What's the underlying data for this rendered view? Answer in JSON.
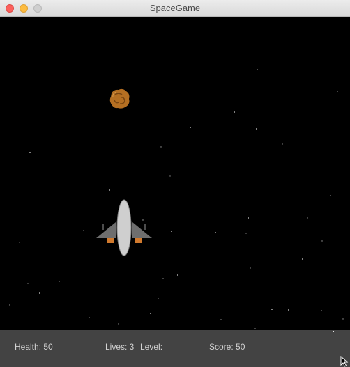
{
  "window": {
    "title": "SpaceGame"
  },
  "hud": {
    "health": "Health: 50",
    "lives": "Lives: 3",
    "level": "Level:",
    "score": "Score: 50"
  },
  "colors": {
    "space": "#000000",
    "hud_bg": "#434343",
    "hud_text": "#d2d2d2",
    "ship_wing": "#6e6e6e",
    "ship_body": "#cfcfcf",
    "ship_thruster": "#d17a2e",
    "asteroid": "#b56f22"
  },
  "icons": [
    "close-icon",
    "minimize-icon",
    "maximize-icon",
    "spaceship-icon",
    "asteroid-icon",
    "star-icon",
    "cursor-icon"
  ]
}
